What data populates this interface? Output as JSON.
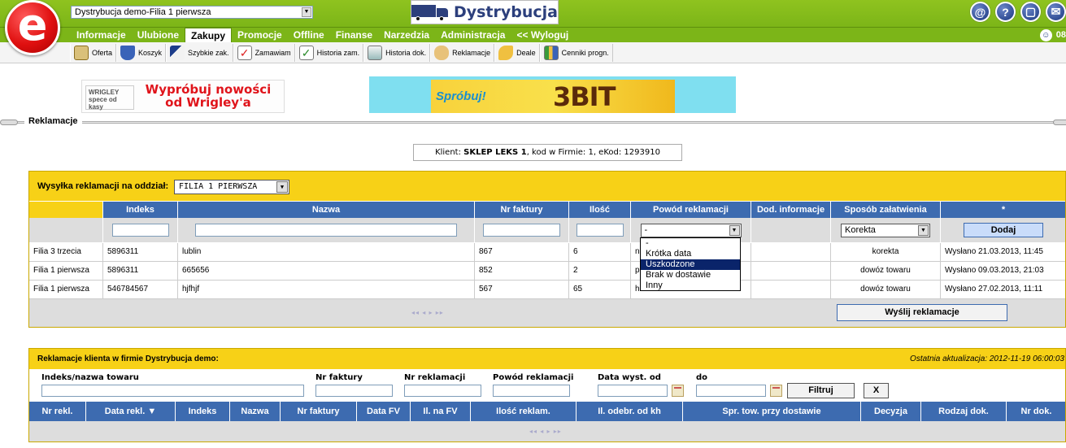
{
  "header": {
    "logo_letter": "e",
    "branch_select": "Dystrybucja demo-Filia 1 pierwsza",
    "brand": "Dystrybucja",
    "top_icons": [
      "@",
      "?",
      "▢",
      "✉"
    ],
    "user_code": "08"
  },
  "menu": [
    {
      "label": "Informacje",
      "active": false
    },
    {
      "label": "Ulubione",
      "active": false
    },
    {
      "label": "Zakupy",
      "active": true
    },
    {
      "label": "Promocje",
      "active": false
    },
    {
      "label": "Offline",
      "active": false
    },
    {
      "label": "Finanse",
      "active": false
    },
    {
      "label": "Narzedzia",
      "active": false
    },
    {
      "label": "Administracja",
      "active": false
    },
    {
      "label": "<< Wyloguj",
      "active": false
    }
  ],
  "toolbar": [
    {
      "label": "Oferta",
      "icon": "offer-icon"
    },
    {
      "label": "Koszyk",
      "icon": "cart-icon"
    },
    {
      "label": "Szybkie zak.",
      "icon": "runner-icon"
    },
    {
      "label": "Zamawiam",
      "icon": "order-icon"
    },
    {
      "label": "Historia zam.",
      "icon": "order-history-icon"
    },
    {
      "label": "Historia dok.",
      "icon": "document-history-icon"
    },
    {
      "label": "Reklamacje",
      "icon": "complaint-icon"
    },
    {
      "label": "Deale",
      "icon": "deal-icon"
    },
    {
      "label": "Cenniki progn.",
      "icon": "pricelist-icon"
    }
  ],
  "banners": {
    "wrigley_logo": "WRIGLEY spece od kasy",
    "wrigley_text": "Wypróbuj nowości od Wrigley'a",
    "bit_promo": "Spróbuj!",
    "bit_brand": "3BIT"
  },
  "section_title": "Reklamacje",
  "client_info": {
    "prefix": "Klient: ",
    "name": "SKLEP LEKS 1",
    "suffix": ", kod w Firmie: 1, eKod: 1293910"
  },
  "complaint_form": {
    "send_label": "Wysyłka reklamacji na oddział:",
    "send_branch": "FILIA 1 PIERWSZA",
    "columns": [
      "",
      "Indeks",
      "Nazwa",
      "Nr faktury",
      "Ilość",
      "Powód reklamacji",
      "Dod. informacje",
      "Sposób załatwienia",
      "*"
    ],
    "reason_value": "-",
    "settlement_value": "Korekta",
    "add_label": "Dodaj",
    "rows": [
      {
        "branch": "Filia 3 trzecia",
        "index": "5896311",
        "name": "lublin",
        "invoice": "867",
        "qty": "6",
        "reason": "n",
        "info": "",
        "settlement": "korekta",
        "status": "Wysłano 21.03.2013, 11:45"
      },
      {
        "branch": "Filia 1 pierwsza",
        "index": "5896311",
        "name": "665656",
        "invoice": "852",
        "qty": "2",
        "reason": "p",
        "info": "",
        "settlement": "dowóz towaru",
        "status": "Wysłano 09.03.2013, 21:03"
      },
      {
        "branch": "Filia 1 pierwsza",
        "index": "546784567",
        "name": "hjfhjf",
        "invoice": "567",
        "qty": "65",
        "reason": "h",
        "info": "",
        "settlement": "dowóz towaru",
        "status": "Wysłano 27.02.2013, 11:11"
      }
    ],
    "pager": "◂◂ ◂  ▸ ▸▸",
    "send_button": "Wyślij reklamacje",
    "reason_options": [
      {
        "label": "-",
        "selected": false
      },
      {
        "label": "Krótka data",
        "selected": false
      },
      {
        "label": "Uszkodzone",
        "selected": true
      },
      {
        "label": "Brak w dostawie",
        "selected": false
      },
      {
        "label": "Inny",
        "selected": false
      }
    ]
  },
  "client_complaints": {
    "title": "Reklamacje klienta w firmie Dystrybucja demo:",
    "last_update": "Ostatnia aktualizacja: 2012-11-19 06:00:03",
    "filters": {
      "product_label": "Indeks/nazwa towaru",
      "invoice_label": "Nr faktury",
      "complaint_no_label": "Nr reklamacji",
      "reason_label": "Powód reklamacji",
      "date_from_label": "Data wyst. od",
      "date_to_label": "do",
      "filter_button": "Filtruj",
      "clear_button": "X"
    },
    "columns": [
      "Nr rekl.",
      "Data rekl. ▼",
      "Indeks",
      "Nazwa",
      "Nr faktury",
      "Data FV",
      "Il. na FV",
      "Ilość reklam.",
      "Il. odebr. od kh",
      "Spr. tow. przy dostawie",
      "Decyzja",
      "Rodzaj dok.",
      "Nr dok."
    ],
    "pager": "◂◂ ◂  ▸ ▸▸"
  }
}
